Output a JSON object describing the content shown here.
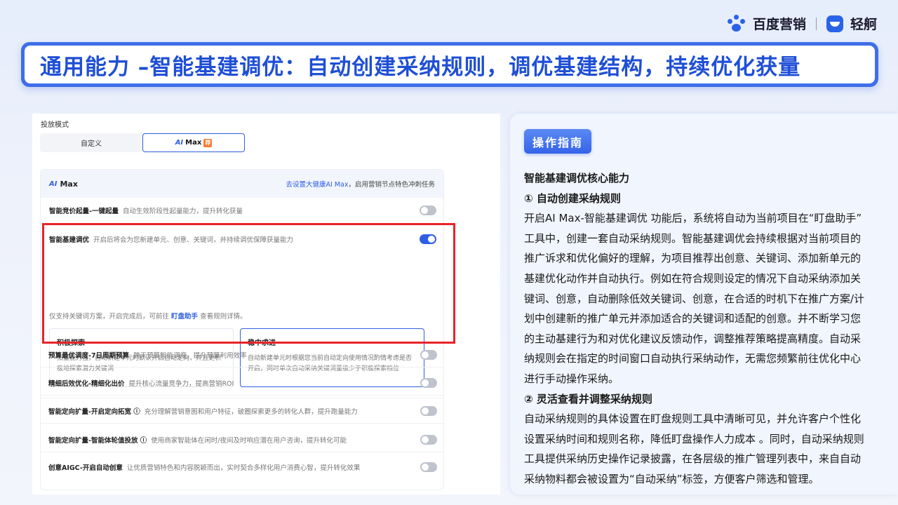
{
  "brand": {
    "baidu": "百度营销",
    "qinghang": "轻舸"
  },
  "title": "通用能力 –智能基建调优：自动创建采纳规则，调优基建结构，持续优化获量",
  "left": {
    "mode_label": "投放模式",
    "tabs": [
      {
        "label": "自定义"
      },
      {
        "ai": "AI",
        "label": "Max",
        "badge": "荐"
      }
    ],
    "card_header": {
      "ai": "AI",
      "title": "Max",
      "link": "去设置大健康AI Max",
      "tail": "，启用营销节点特色冲刺任务"
    },
    "rows": [
      {
        "name": "智能竞价起量-一键起量",
        "desc": "自动生效阶段性起量能力，提升转化获量",
        "on": false
      },
      {
        "name": "智能基建调优",
        "desc": "开启后将会为您新建单元、创意、关键词，并持续调优保障获量能力",
        "on": true
      },
      {
        "name": "预算最优调度-7日周期预算",
        "desc": "跨天预算智能调度，提升预算利用效率",
        "on": false
      },
      {
        "name": "精细后效优化-精细化出价",
        "desc": "提升核心流量竞争力，提高营销ROI",
        "on": false
      },
      {
        "name": "智能定向扩量-开启定向拓宽 ⓘ",
        "desc": "充分理解营销意图和用户特征，破圈探索更多的转化人群，提升跑量能力",
        "on": false
      },
      {
        "name": "智能定向扩量-智能体轮值投放 ⓘ",
        "desc": "使用商家智能体在闲时/夜间及时响应潜在用户咨询，提升转化可能",
        "on": false
      },
      {
        "name": "创意AIGC-开启自动创意",
        "desc": "让优质营销特色和内容脱颖而出，实时契合多样化用户消费心智，提升转化效果",
        "on": false
      }
    ],
    "sub_note": {
      "pre": "仅支持关键词方案，开启完成后，可前往",
      "link": "盯盘助手",
      "post": "查看规则详情。"
    },
    "options": [
      {
        "title": "积极探索",
        "desc": "拓量能力强，自动新建单元时默认开启自动定向，并且更积极地探索潜力关键词"
      },
      {
        "title": "稳中求进",
        "desc": "自动新建单元时根据您当前自动定向使用情况酌情考虑是否开启，同时单次自动采纳关键词量级少于积极探索档位"
      }
    ]
  },
  "guide": {
    "tag": "操作指南",
    "lines": [
      "智能基建调优核心能力",
      "① 自动创建采纳规则",
      "开启AI Max-智能基建调优 功能后，系统将自动为当前项目在“盯盘助手”",
      "工具中，创建一套自动采纳规则。智能基建调优会持续根据对当前项目的",
      "推广诉求和优化偏好的理解，为项目推荐出创意、关键词、添加新单元的",
      "基建优化动作并自动执行。例如在符合规则设定的情况下自动采纳添加关",
      "键词、创意，自动删除低效关键词、创意，在合适的时机下在推广方案/计",
      "划中创建新的推广单元并添加适合的关键词和适配的创意。并不断学习您",
      "的主动基建行为和对优化建议反馈动作，调整推荐策略提高精度。自动采",
      "纳规则会在指定的时间窗口自动执行采纳动作，无需您频繁前往优化中心",
      "进行手动操作采纳。",
      "② 灵活查看并调整采纳规则",
      "自动采纳规则的具体设置在盯盘规则工具中清晰可见，并允许客户个性化",
      "设置采纳时间和规则名称，降低盯盘操作人力成本 。同时，自动采纳规则",
      "工具提供采纳历史操作记录披露，在各层级的推广管理列表中，来自自动",
      "采纳物料都会被设置为“自动采纳”标签，方便客户筛选和管理。"
    ]
  }
}
